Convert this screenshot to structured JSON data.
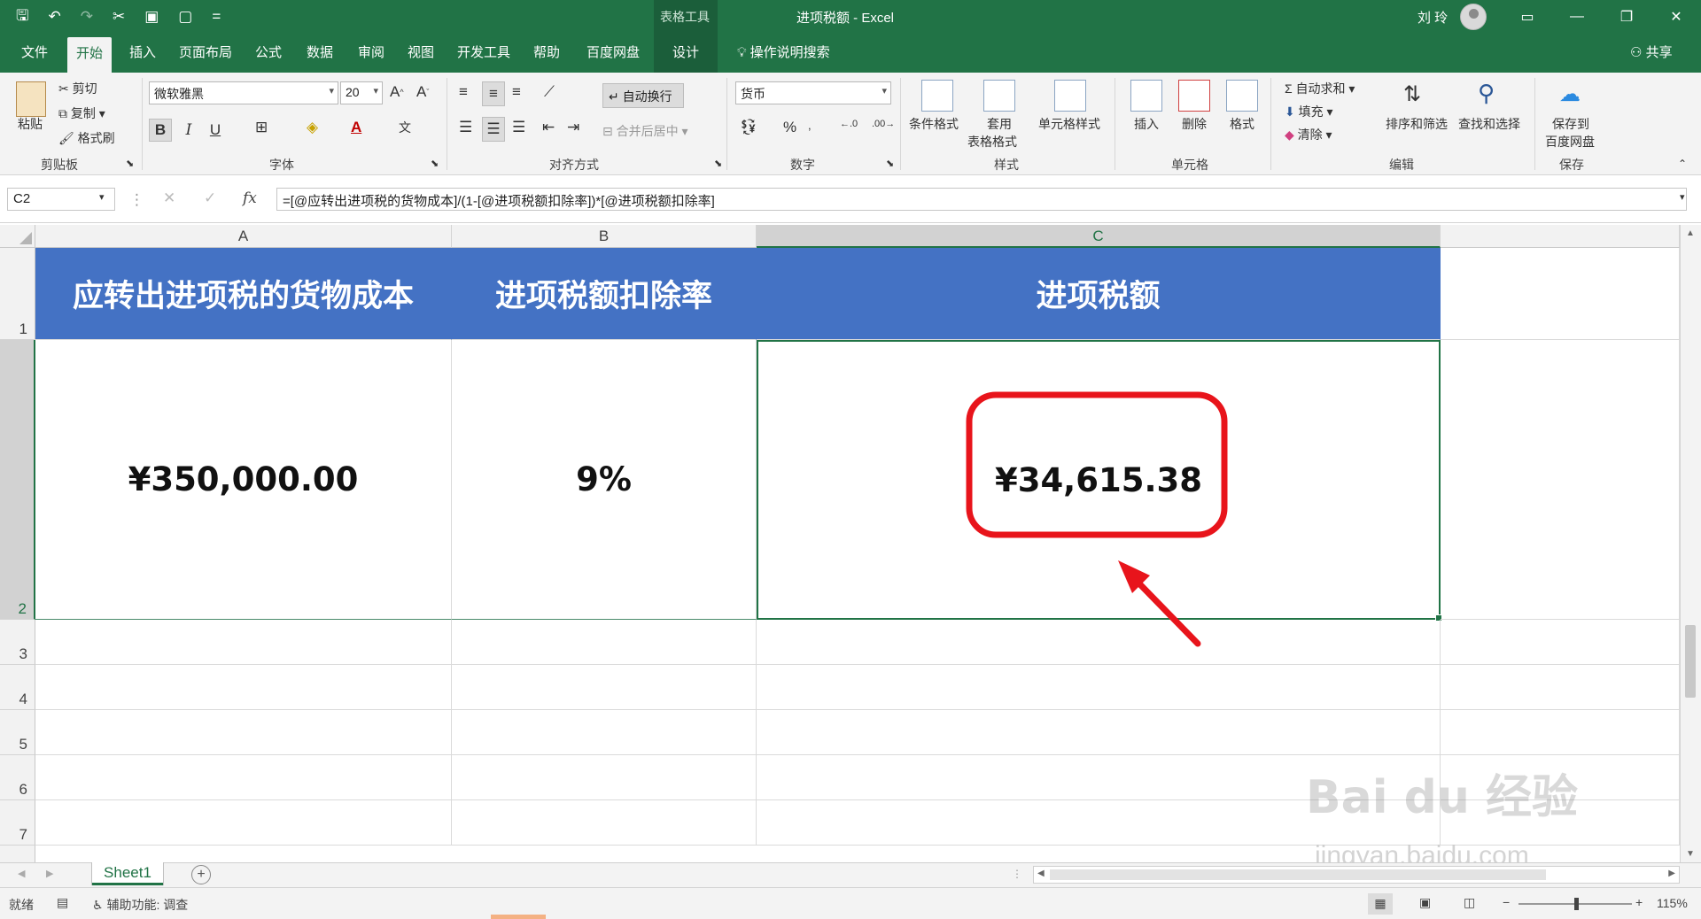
{
  "titlebar": {
    "context_group": "表格工具",
    "document_title": "进项税额  -  Excel",
    "user_name": "刘 玲",
    "qat_more": "="
  },
  "tabs": [
    "文件",
    "开始",
    "插入",
    "页面布局",
    "公式",
    "数据",
    "审阅",
    "视图",
    "开发工具",
    "帮助",
    "百度网盘",
    "设计"
  ],
  "tell_me": "操作说明搜索",
  "share": "共享",
  "ribbon": {
    "clipboard": {
      "paste": "粘贴",
      "cut": "剪切",
      "copy": "复制",
      "format_painter": "格式刷",
      "label": "剪贴板"
    },
    "font": {
      "name": "微软雅黑",
      "size": "20",
      "bold": "B",
      "italic": "I",
      "underline": "U",
      "label": "字体"
    },
    "alignment": {
      "wrap_text": "自动换行",
      "merge_center": "合并后居中",
      "label": "对齐方式"
    },
    "number": {
      "format": "货币",
      "percent": "%",
      "label": "数字"
    },
    "styles": {
      "conditional": "条件格式",
      "table_1": "套用",
      "table_2": "表格格式",
      "cell_styles": "单元格样式",
      "label": "样式"
    },
    "cells": {
      "insert": "插入",
      "delete": "删除",
      "format": "格式",
      "label": "单元格"
    },
    "editing": {
      "autosum": "自动求和",
      "fill": "填充",
      "clear": "清除",
      "sort_filter": "排序和筛选",
      "find_select": "查找和选择",
      "label": "编辑"
    },
    "save": {
      "save_1": "保存到",
      "save_2": "百度网盘",
      "label": "保存"
    }
  },
  "formula_bar": {
    "name_box": "C2",
    "fx": "fx",
    "formula": "=[@应转出进项税的货物成本]/(1-[@进项税额扣除率])*[@进项税额扣除率]"
  },
  "columns": [
    "A",
    "B",
    "C"
  ],
  "rows": [
    "1",
    "2",
    "3",
    "4",
    "5",
    "6",
    "7"
  ],
  "table": {
    "headers": [
      "应转出进项税的货物成本",
      "进项税额扣除率",
      "进项税额"
    ],
    "values": [
      "¥350,000.00",
      "9%",
      "¥34,615.38"
    ]
  },
  "sheets": [
    "Sheet1"
  ],
  "status": {
    "ready": "就绪",
    "accessibility": "辅助功能: 调查",
    "zoom": "115%"
  },
  "watermark": {
    "line1": "Bai du 经验",
    "line2": "jingyan.baidu.com"
  },
  "colors": {
    "excel_green": "#217346",
    "header_blue": "#4472c4",
    "highlight_red": "#e8141b"
  }
}
